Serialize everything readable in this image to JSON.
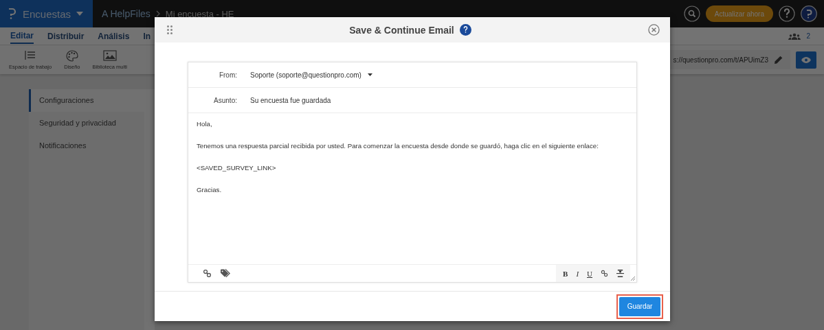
{
  "app_bar": {
    "product": "Encuestas",
    "breadcrumb": [
      "A HelpFiles",
      "Mi encuesta - HE"
    ],
    "upgrade_button": "Actualizar ahora"
  },
  "nav_tabs": [
    {
      "label": "Editar",
      "selected": true
    },
    {
      "label": "Distribuir",
      "selected": false
    },
    {
      "label": "Análisis",
      "selected": false
    },
    {
      "label": "In",
      "selected": false
    }
  ],
  "collaborators_count": "2",
  "toolbar": [
    {
      "label": "Espacio de trabajo",
      "kind": "workspace"
    },
    {
      "label": "Diseño",
      "kind": "palette"
    },
    {
      "label": "Biblioteca multi",
      "kind": "image"
    }
  ],
  "survey_url": "s://questionpro.com/t/APUimZ3",
  "sidebar": [
    {
      "label": "Configuraciones",
      "selected": true
    },
    {
      "label": "Seguridad y privacidad",
      "selected": false
    },
    {
      "label": "Notificaciones",
      "selected": false
    }
  ],
  "dialog": {
    "title": "Save & Continue Email",
    "from_label": "From:",
    "from_value": "Soporte (soporte@questionpro.com)",
    "subject_label": "Asunto:",
    "subject_value": "Su encuesta fue guardada",
    "body": [
      "Hola,",
      "Tenemos una respuesta parcial recibida por usted. Para comenzar la encuesta desde donde se guardó, haga clic en el siguiente enlace:",
      "<SAVED_SURVEY_LINK>",
      "Gracias."
    ],
    "format_buttons": [
      {
        "label": "B",
        "kind": "bold"
      },
      {
        "label": "I",
        "kind": "italic"
      },
      {
        "label": "U",
        "kind": "underline"
      }
    ],
    "save_button": "Guardar"
  }
}
